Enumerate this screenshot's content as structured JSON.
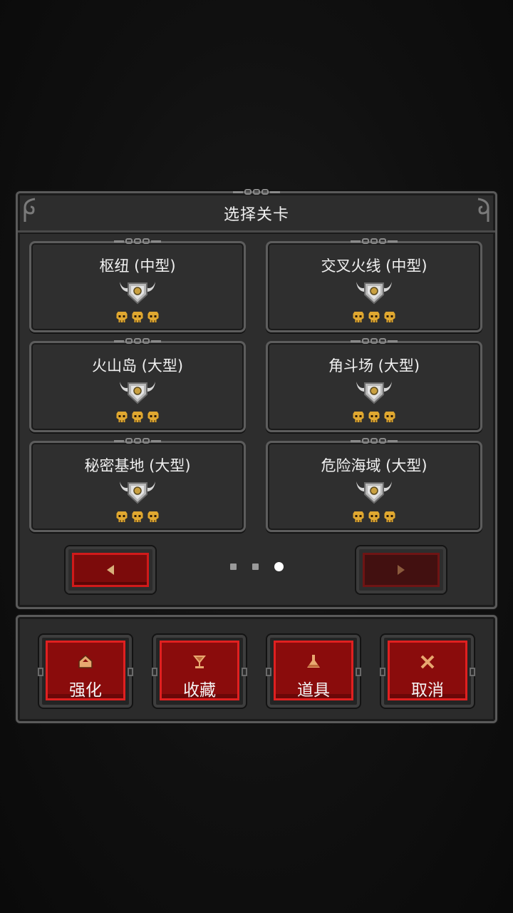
{
  "panel": {
    "title": "选择关卡"
  },
  "levels": [
    {
      "name": "枢纽 (中型)",
      "skulls": 3
    },
    {
      "name": "交叉火线 (中型)",
      "skulls": 3
    },
    {
      "name": "火山岛 (大型)",
      "skulls": 3
    },
    {
      "name": "角斗场 (大型)",
      "skulls": 3
    },
    {
      "name": "秘密基地 (大型)",
      "skulls": 3
    },
    {
      "name": "危险海域 (大型)",
      "skulls": 3
    }
  ],
  "pagination": {
    "current_page": 3,
    "total_pages": 3,
    "next_disabled": true
  },
  "actions": [
    {
      "label": "强化",
      "icon": "upgrade-icon"
    },
    {
      "label": "收藏",
      "icon": "trophy-icon"
    },
    {
      "label": "道具",
      "icon": "potion-icon"
    },
    {
      "label": "取消",
      "icon": "close-icon"
    }
  ],
  "colors": {
    "accent_red": "#e02020",
    "button_fill": "#8a0c0c",
    "skull_gold": "#e0a830",
    "icon_tan": "#e8a870"
  }
}
